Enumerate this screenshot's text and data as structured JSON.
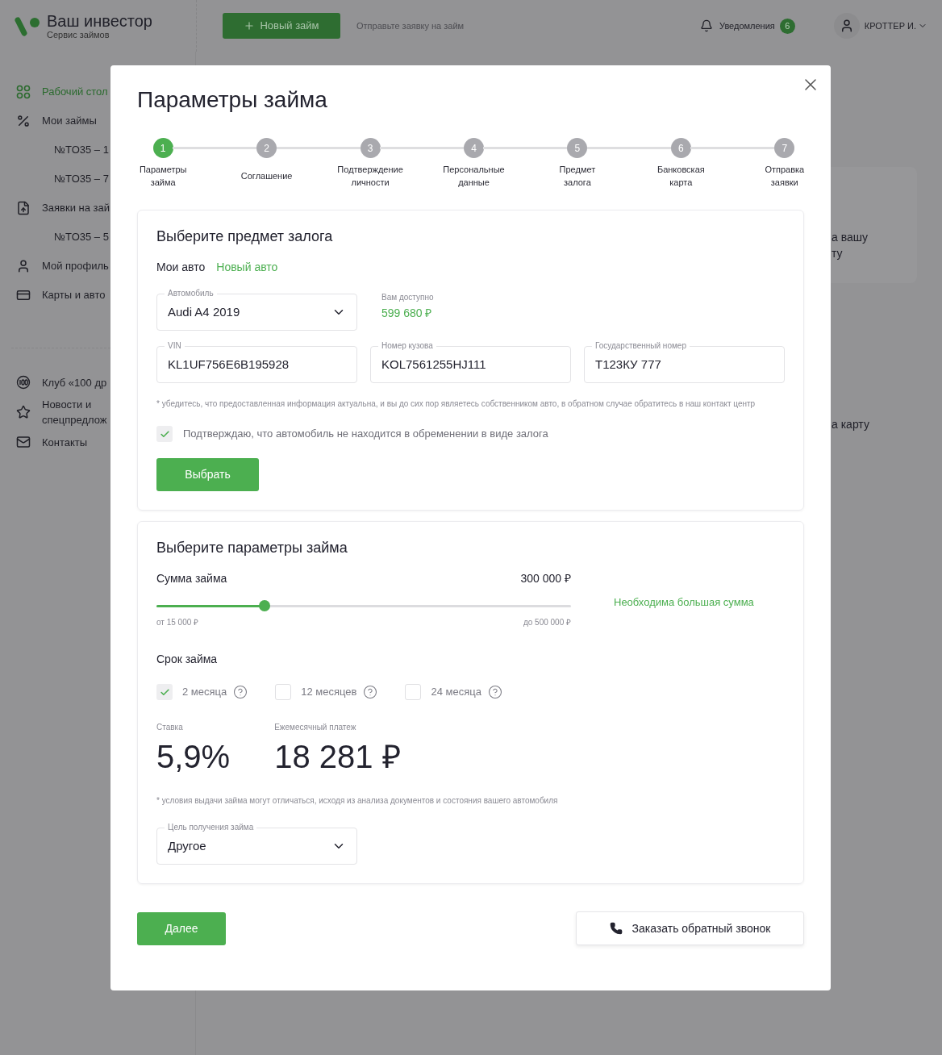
{
  "header": {
    "logo_title": "Ваш инвестор",
    "logo_subtitle": "Сервис займов",
    "new_loan_button": "Новый займ",
    "hint": "Отправьте заявку на займ",
    "notifications": {
      "label": "Уведомления",
      "count": "6"
    },
    "user": "КРОТТЕР И."
  },
  "sidebar": {
    "items": [
      {
        "label": "Рабочий стол",
        "selected": true
      },
      {
        "label": "Мои займы",
        "selected": false,
        "children": [
          {
            "label": "№TO35 – 1"
          },
          {
            "label": "№TO35 – 7"
          }
        ]
      },
      {
        "label": "Заявки на зай",
        "selected": false,
        "children": [
          {
            "label": "№TO35 – 5"
          }
        ]
      },
      {
        "label": "Мой профиль",
        "selected": false
      },
      {
        "label": "Карты и авто",
        "selected": false
      }
    ],
    "extra_items": [
      {
        "label": "Клуб «100 др"
      },
      {
        "label": "Новости и\nспецпредлож"
      },
      {
        "label": "Контакты"
      }
    ]
  },
  "background_texts": [
    {
      "text": "а вашу\nту"
    },
    {
      "text": "а карту"
    }
  ],
  "modal": {
    "title": "Параметры займа",
    "steps": [
      {
        "number": "1",
        "label": "Параметры\nзайма",
        "selected": true
      },
      {
        "number": "2",
        "label": "Соглашение",
        "selected": false
      },
      {
        "number": "3",
        "label": "Подтверждение\nличности",
        "selected": false
      },
      {
        "number": "4",
        "label": "Персональные\nданные",
        "selected": false
      },
      {
        "number": "5",
        "label": "Предмет\nзалога",
        "selected": false
      },
      {
        "number": "6",
        "label": "Банковская\nкарта",
        "selected": false
      },
      {
        "number": "7",
        "label": "Отправка\nзаявки",
        "selected": false
      }
    ],
    "collateral": {
      "title": "Выберите предмет залога",
      "tabs": [
        {
          "label": "Мои авто",
          "selected": true
        },
        {
          "label": "Новый авто",
          "selected": false
        }
      ],
      "car_select": {
        "label": "Автомобиль",
        "value": "Audi A4 2019"
      },
      "available": {
        "label": "Вам доступно",
        "value": "599 680 ₽"
      },
      "fields": [
        {
          "label": "VIN",
          "value": "KL1UF756E6B195928"
        },
        {
          "label": "Номер кузова",
          "value": "KOL7561255HJ111"
        },
        {
          "label": "Государственный номер",
          "value": "Т123КУ 777"
        }
      ],
      "note": "* убедитесь, что предоставленная информация актуальна, и вы до сих пор являетесь собственником авто, в обратном случае обратитесь в наш контакт центр",
      "confirm": {
        "label": "Подтверждаю, что автомобиль не находится в обременении в виде залога",
        "checked": true
      },
      "button": "Выбрать"
    },
    "params": {
      "title": "Выберите параметры займа",
      "amount": {
        "label": "Сумма займа",
        "value": "300 000 ₽",
        "level": 0.26,
        "min": "от 15 000 ₽",
        "max": "до 500 000 ₽"
      },
      "more_link": "Необходима большая сумма",
      "term": {
        "label": "Срок займа",
        "options": [
          {
            "label": "2 месяца",
            "selected": true
          },
          {
            "label": "12 месяцев",
            "selected": false
          },
          {
            "label": "24 месяца",
            "selected": false
          }
        ]
      },
      "rate": {
        "label": "Ставка",
        "value": "5,9%"
      },
      "payment": {
        "label": "Ежемесячный платеж",
        "value": "18 281 ₽"
      },
      "note": "* условия выдачи займа могут отличаться, исходя из анализа документов и состояния вашего автомобиля",
      "purpose": {
        "label": "Цель получения займа",
        "value": "Другое"
      }
    },
    "next_button": "Далее",
    "callback_button": "Заказать обратный звонок"
  }
}
